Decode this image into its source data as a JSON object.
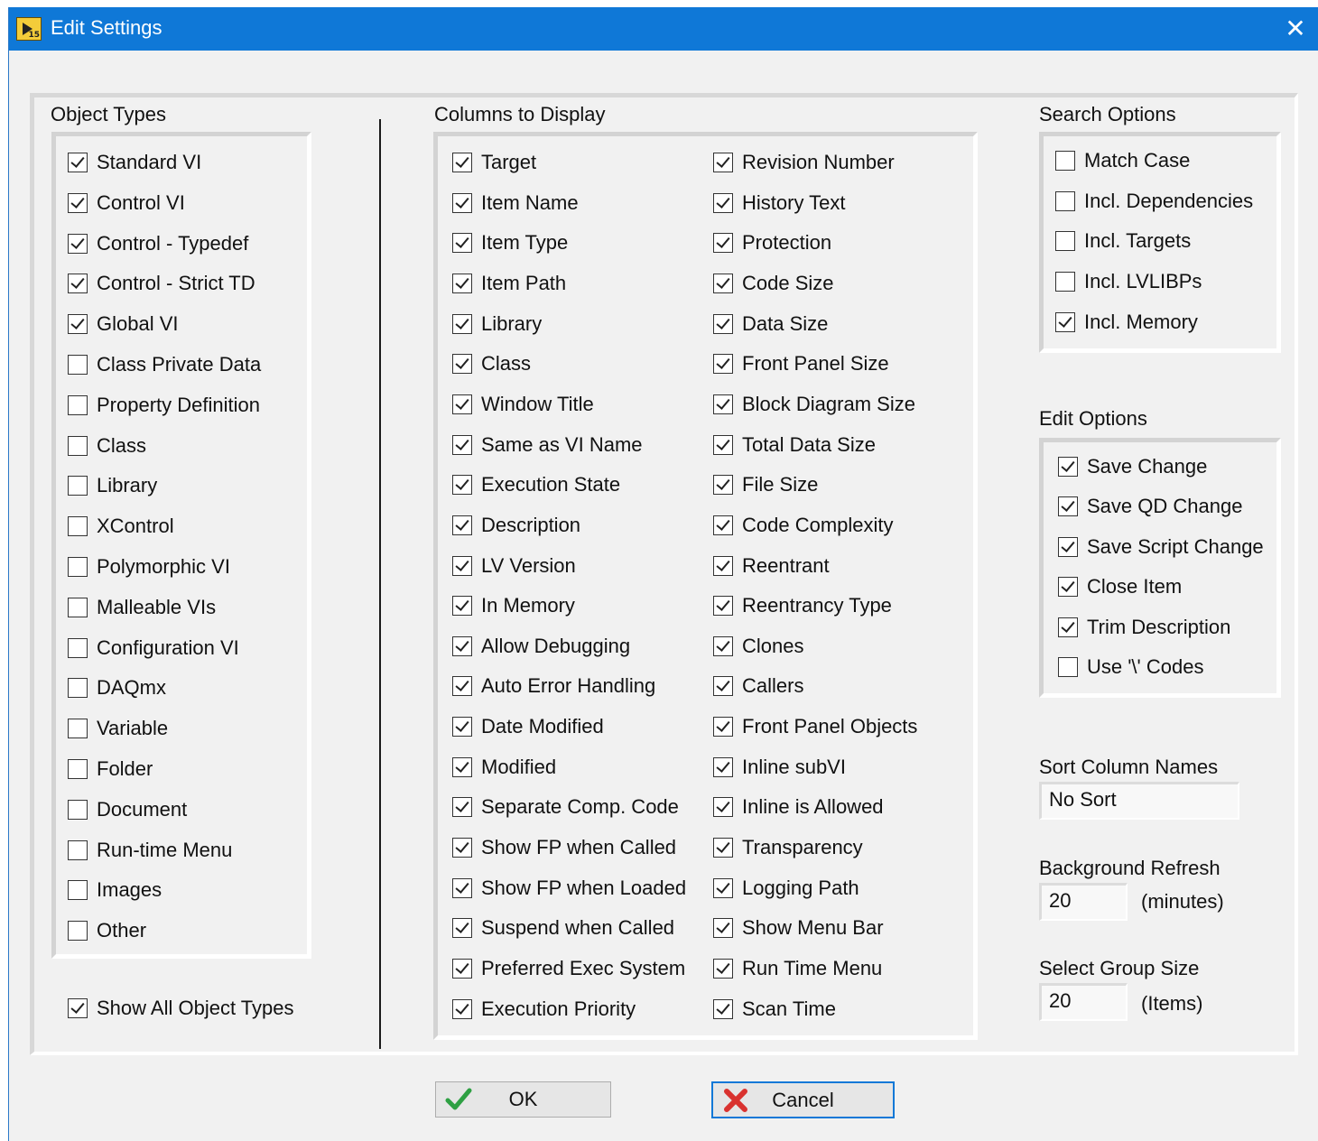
{
  "window": {
    "title": "Edit Settings"
  },
  "object_types": {
    "label": "Object Types",
    "items": [
      {
        "label": "Standard VI",
        "checked": true
      },
      {
        "label": "Control VI",
        "checked": true
      },
      {
        "label": "Control - Typedef",
        "checked": true
      },
      {
        "label": "Control - Strict TD",
        "checked": true
      },
      {
        "label": "Global VI",
        "checked": true
      },
      {
        "label": "Class Private Data",
        "checked": false
      },
      {
        "label": "Property Definition",
        "checked": false
      },
      {
        "label": "Class",
        "checked": false
      },
      {
        "label": "Library",
        "checked": false
      },
      {
        "label": "XControl",
        "checked": false
      },
      {
        "label": "Polymorphic VI",
        "checked": false
      },
      {
        "label": "Malleable VIs",
        "checked": false
      },
      {
        "label": "Configuration VI",
        "checked": false
      },
      {
        "label": "DAQmx",
        "checked": false
      },
      {
        "label": "Variable",
        "checked": false
      },
      {
        "label": "Folder",
        "checked": false
      },
      {
        "label": "Document",
        "checked": false
      },
      {
        "label": "Run-time Menu",
        "checked": false
      },
      {
        "label": "Images",
        "checked": false
      },
      {
        "label": "Other",
        "checked": false
      }
    ],
    "show_all": {
      "label": "Show All Object Types",
      "checked": true
    }
  },
  "columns": {
    "label": "Columns to Display",
    "left": [
      {
        "label": "Target",
        "checked": true
      },
      {
        "label": "Item Name",
        "checked": true
      },
      {
        "label": "Item Type",
        "checked": true
      },
      {
        "label": "Item Path",
        "checked": true
      },
      {
        "label": "Library",
        "checked": true
      },
      {
        "label": "Class",
        "checked": true
      },
      {
        "label": "Window Title",
        "checked": true
      },
      {
        "label": "Same as VI Name",
        "checked": true
      },
      {
        "label": "Execution State",
        "checked": true
      },
      {
        "label": "Description",
        "checked": true
      },
      {
        "label": "LV Version",
        "checked": true
      },
      {
        "label": "In Memory",
        "checked": true
      },
      {
        "label": "Allow Debugging",
        "checked": true
      },
      {
        "label": "Auto Error Handling",
        "checked": true
      },
      {
        "label": "Date Modified",
        "checked": true
      },
      {
        "label": "Modified",
        "checked": true
      },
      {
        "label": "Separate Comp. Code",
        "checked": true
      },
      {
        "label": "Show FP when Called",
        "checked": true
      },
      {
        "label": "Show FP when Loaded",
        "checked": true
      },
      {
        "label": "Suspend when Called",
        "checked": true
      },
      {
        "label": "Preferred Exec System",
        "checked": true
      },
      {
        "label": "Execution Priority",
        "checked": true
      }
    ],
    "right": [
      {
        "label": "Revision Number",
        "checked": true
      },
      {
        "label": "History Text",
        "checked": true
      },
      {
        "label": "Protection",
        "checked": true
      },
      {
        "label": "Code Size",
        "checked": true
      },
      {
        "label": "Data Size",
        "checked": true
      },
      {
        "label": "Front Panel Size",
        "checked": true
      },
      {
        "label": "Block Diagram Size",
        "checked": true
      },
      {
        "label": "Total Data Size",
        "checked": true
      },
      {
        "label": "File Size",
        "checked": true
      },
      {
        "label": "Code Complexity",
        "checked": true
      },
      {
        "label": "Reentrant",
        "checked": true
      },
      {
        "label": "Reentrancy Type",
        "checked": true
      },
      {
        "label": "Clones",
        "checked": true
      },
      {
        "label": "Callers",
        "checked": true
      },
      {
        "label": "Front Panel Objects",
        "checked": true
      },
      {
        "label": "Inline subVI",
        "checked": true
      },
      {
        "label": "Inline is Allowed",
        "checked": true
      },
      {
        "label": "Transparency",
        "checked": true
      },
      {
        "label": "Logging Path",
        "checked": true
      },
      {
        "label": "Show Menu Bar",
        "checked": true
      },
      {
        "label": "Run Time Menu",
        "checked": true
      },
      {
        "label": "Scan Time",
        "checked": true
      }
    ]
  },
  "search_options": {
    "label": "Search Options",
    "items": [
      {
        "label": "Match Case",
        "checked": false
      },
      {
        "label": "Incl. Dependencies",
        "checked": false
      },
      {
        "label": "Incl. Targets",
        "checked": false
      },
      {
        "label": "Incl. LVLIBPs",
        "checked": false
      },
      {
        "label": "Incl. Memory",
        "checked": true
      }
    ]
  },
  "edit_options": {
    "label": "Edit Options",
    "items": [
      {
        "label": "Save Change",
        "checked": true
      },
      {
        "label": "Save QD Change",
        "checked": true
      },
      {
        "label": "Save Script Change",
        "checked": true
      },
      {
        "label": "Close Item",
        "checked": true
      },
      {
        "label": "Trim Description",
        "checked": true
      },
      {
        "label": "Use '\\' Codes",
        "checked": false
      }
    ]
  },
  "sort_column": {
    "label": "Sort Column Names",
    "value": "No Sort"
  },
  "background_refresh": {
    "label": "Background Refresh",
    "value": "20",
    "unit": "(minutes)"
  },
  "select_group": {
    "label": "Select Group Size",
    "value": "20",
    "unit": "(Items)"
  },
  "buttons": {
    "ok": "OK",
    "cancel": "Cancel"
  },
  "colors": {
    "titlebar": "#0f78d7",
    "ok_icon": "#2ea043",
    "cancel_icon": "#d9322f",
    "focus_border": "#0f78d7"
  }
}
